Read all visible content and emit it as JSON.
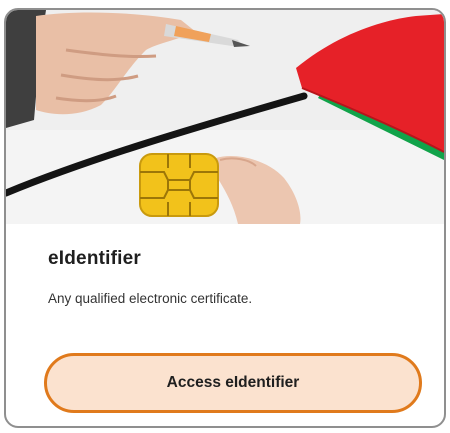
{
  "card": {
    "title": "eIdentifier",
    "description": "Any qualified electronic certificate.",
    "button_label": "Access eIdentifier",
    "image_subject": "smart-card-chip-photo"
  },
  "colors": {
    "border": "#8f8f8f",
    "button_border": "#e07a1c",
    "button_fill": "#fbe2cf",
    "chip_gold": "#f2c21b",
    "folder_red": "#e8232a",
    "folder_green": "#19a64a"
  }
}
